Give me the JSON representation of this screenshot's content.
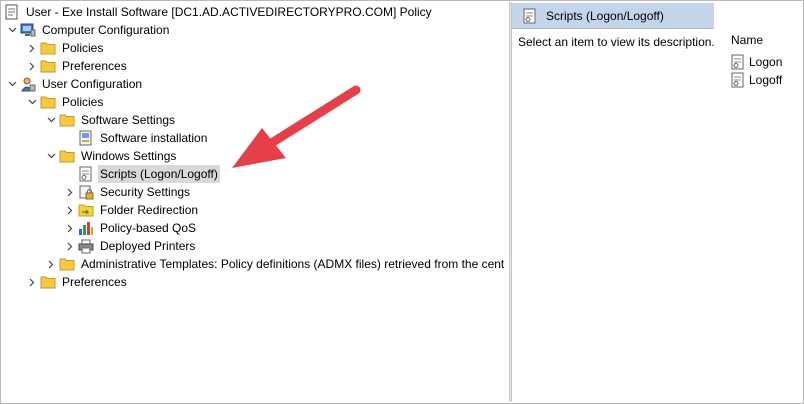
{
  "tree": {
    "root": "User - Exe Install Software [DC1.AD.ACTIVEDIRECTORYPRO.COM] Policy",
    "computer_configuration": "Computer Configuration",
    "cc_policies": "Policies",
    "cc_preferences": "Preferences",
    "user_configuration": "User Configuration",
    "uc_policies": "Policies",
    "software_settings": "Software Settings",
    "software_installation": "Software installation",
    "windows_settings": "Windows Settings",
    "scripts": "Scripts (Logon/Logoff)",
    "security_settings": "Security Settings",
    "folder_redirection": "Folder Redirection",
    "policy_qos": "Policy-based QoS",
    "deployed_printers": "Deployed Printers",
    "admin_templates": "Administrative Templates: Policy definitions (ADMX files) retrieved from the cent",
    "uc_preferences": "Preferences"
  },
  "right_pane": {
    "header": "Scripts (Logon/Logoff)",
    "description": "Select an item to view its description.",
    "column_name": "Name",
    "items": [
      "Logon",
      "Logoff"
    ]
  },
  "colors": {
    "header_bg": "#c4d5ea",
    "selection_bg": "#d9d9d9",
    "folder_yellow": "#f5c944",
    "arrow_red": "#e5404a"
  }
}
